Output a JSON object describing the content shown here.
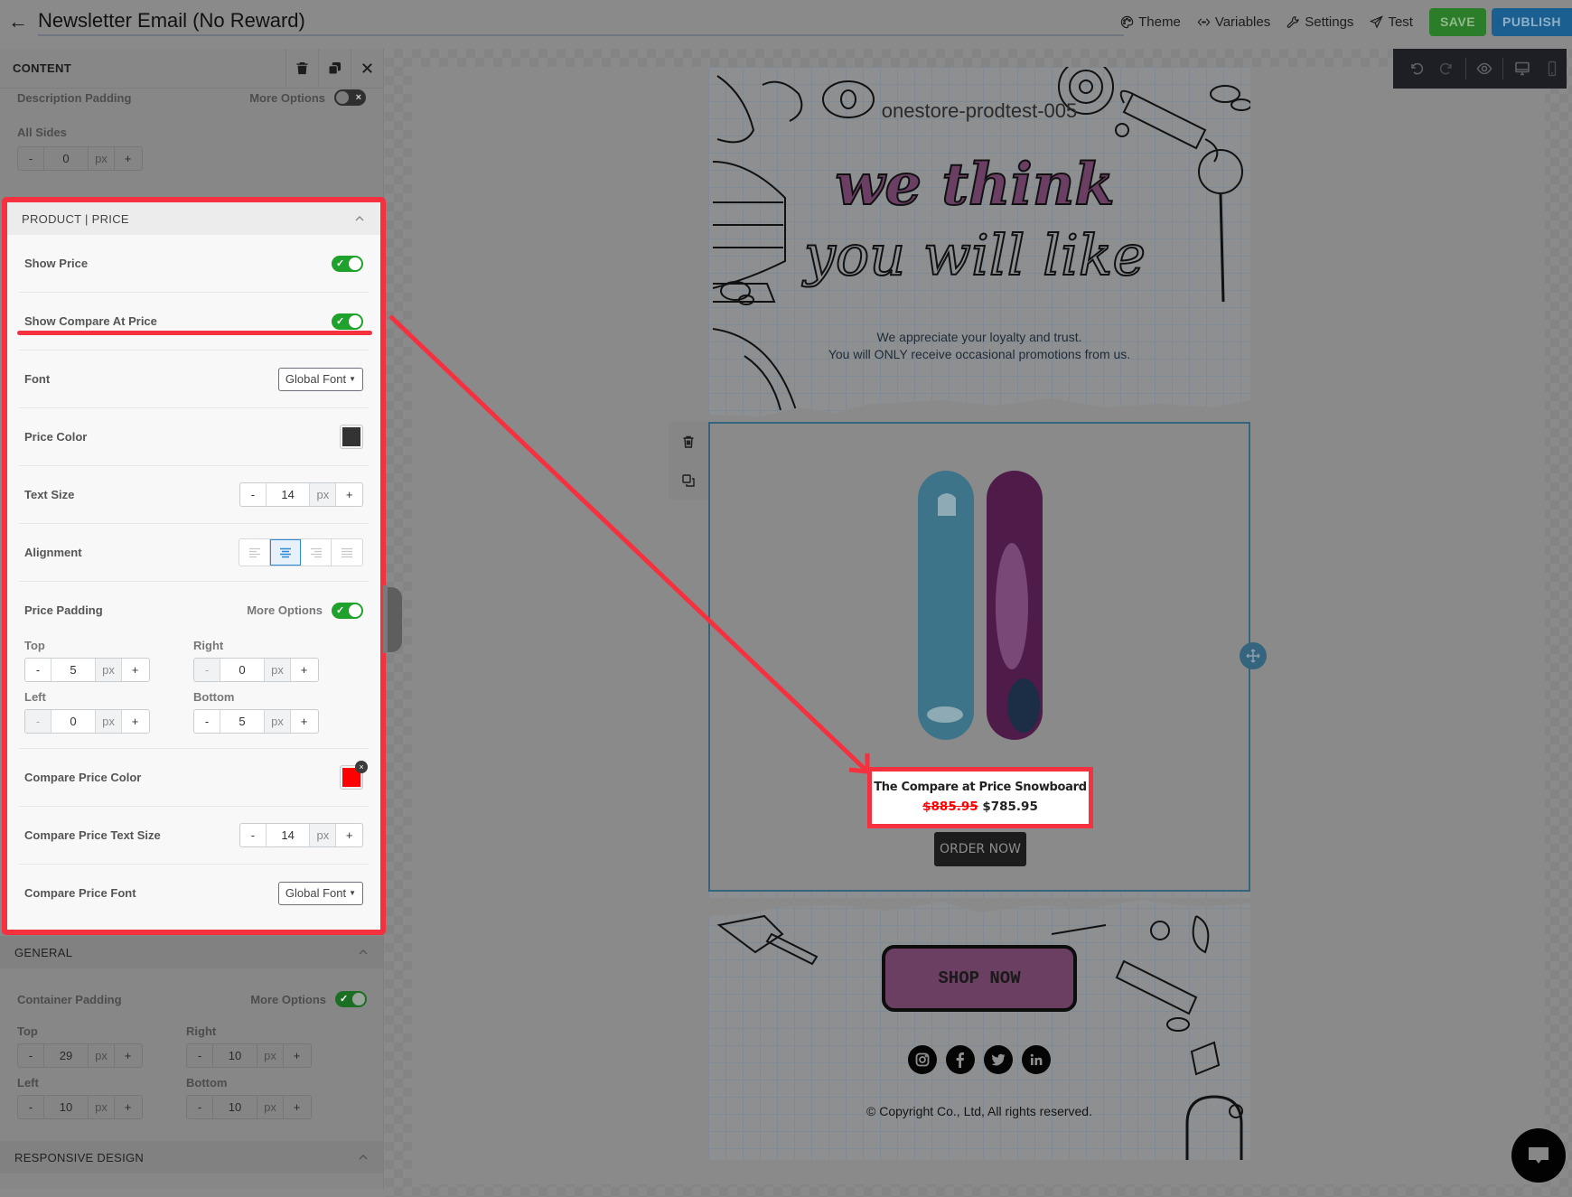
{
  "header": {
    "title": "Newsletter Email (No Reward)",
    "links": [
      {
        "label": "Theme",
        "icon": "palette-icon"
      },
      {
        "label": "Variables",
        "icon": "code-brackets-icon"
      },
      {
        "label": "Settings",
        "icon": "wrench-icon"
      },
      {
        "label": "Test",
        "icon": "send-icon"
      }
    ],
    "save_label": "SAVE",
    "publish_label": "PUBLISH"
  },
  "panel": {
    "title": "CONTENT",
    "description_padding": {
      "label": "Description Padding",
      "more_options_label": "More Options",
      "more_options_on": false,
      "all_sides_label": "All Sides",
      "all_sides_value": "0",
      "unit": "px"
    },
    "product_price": {
      "section_title": "PRODUCT | PRICE",
      "show_price_label": "Show Price",
      "show_price_on": true,
      "show_compare_label": "Show Compare At Price",
      "show_compare_on": true,
      "font_label": "Font",
      "font_value": "Global Font",
      "price_color_label": "Price Color",
      "price_color": "#333333",
      "text_size_label": "Text Size",
      "text_size_value": "14",
      "alignment_label": "Alignment",
      "alignment_options": [
        "left",
        "center",
        "right",
        "justify"
      ],
      "alignment_selected": "center",
      "price_padding_label": "Price Padding",
      "more_options_label": "More Options",
      "price_padding_more_on": true,
      "padding": {
        "top_label": "Top",
        "top": "5",
        "right_label": "Right",
        "right": "0",
        "left_label": "Left",
        "left": "0",
        "bottom_label": "Bottom",
        "bottom": "5"
      },
      "compare_color_label": "Compare Price Color",
      "compare_color": "#ff0000",
      "compare_size_label": "Compare Price Text Size",
      "compare_size_value": "14",
      "compare_font_label": "Compare Price Font",
      "compare_font_value": "Global Font",
      "unit": "px"
    },
    "general": {
      "section_title": "GENERAL",
      "container_padding_label": "Container Padding",
      "more_options_label": "More Options",
      "more_options_on": true,
      "padding": {
        "top_label": "Top",
        "top": "29",
        "right_label": "Right",
        "right": "10",
        "left_label": "Left",
        "left": "10",
        "bottom_label": "Bottom",
        "bottom": "10"
      },
      "unit": "px"
    },
    "responsive": {
      "section_title": "RESPONSIVE DESIGN"
    },
    "stepper_minus": "-",
    "stepper_plus": "+"
  },
  "email": {
    "store_name": "onestore-prodtest-005",
    "headline_line1": "we think",
    "headline_line2": "you will like",
    "appreciate_line1": "We appreciate your loyalty and trust.",
    "appreciate_line2": "You will ONLY receive occasional promotions from us.",
    "product": {
      "name": "The Compare at Price Snowboard",
      "compare_price": "$885.95",
      "price": "$785.95",
      "button_label": "ORDER NOW"
    },
    "shop_button_label": "SHOP NOW",
    "socials": [
      "instagram",
      "facebook",
      "twitter",
      "linkedin"
    ],
    "copyright": "© Copyright Co., Ltd, All rights reserved."
  },
  "colors": {
    "highlight": "#f5303f",
    "toggle_on": "#1fa22b",
    "save": "#2c7d2a",
    "publish": "#1a5f8f",
    "compare_price": "#ff0000"
  }
}
